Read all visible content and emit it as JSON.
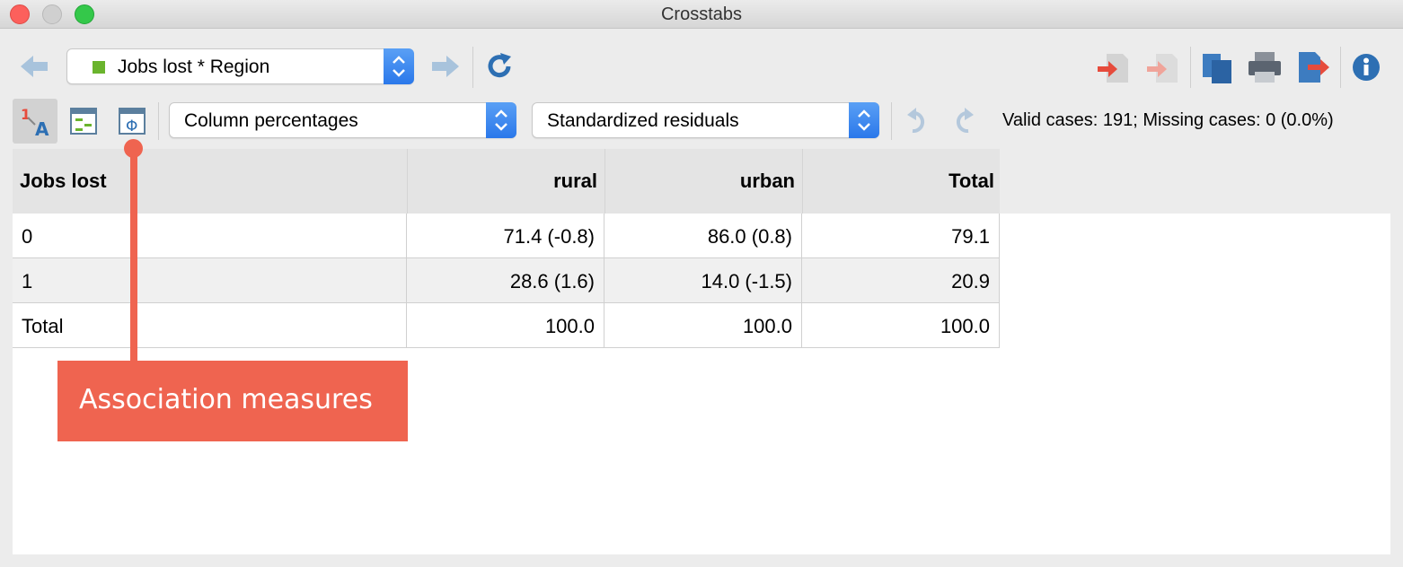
{
  "window": {
    "title": "Crosstabs"
  },
  "toolbar": {
    "analysis_select": {
      "value": "Jobs lost * Region",
      "color": "#6ab42d"
    },
    "percent_select": {
      "value": "Column percentages"
    },
    "residual_select": {
      "value": "Standardized residuals"
    },
    "status": "Valid cases: 191;  Missing cases: 0 (0.0%)",
    "icons": [
      "back-arrow-icon",
      "forward-arrow-icon",
      "refresh-icon",
      "labels-icon",
      "layout-icon",
      "phi-icon",
      "undo-icon",
      "redo-icon",
      "export-in-icon",
      "export-out-icon",
      "copy-icon",
      "print-icon",
      "export-icon",
      "info-icon"
    ]
  },
  "table": {
    "headers": [
      "Jobs lost",
      "rural",
      "urban",
      "Total"
    ],
    "rows": [
      [
        "0",
        "71.4 (-0.8)",
        "86.0 (0.8)",
        "79.1"
      ],
      [
        "1",
        "28.6 (1.6)",
        "14.0 (-1.5)",
        "20.9"
      ],
      [
        "Total",
        "100.0",
        "100.0",
        "100.0"
      ]
    ]
  },
  "callout": {
    "text": "Association measures",
    "color": "#ef6450"
  }
}
